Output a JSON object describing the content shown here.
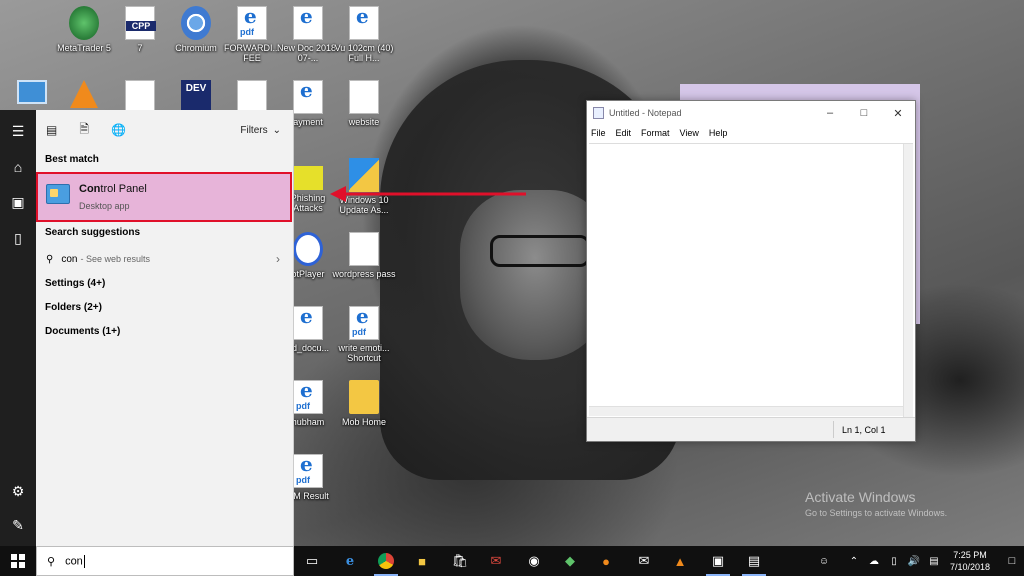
{
  "desktop": {
    "icons": [
      {
        "label": "MetaTrader 5"
      },
      {
        "label": "7"
      },
      {
        "label": "Chromium"
      },
      {
        "label": "FORWARDI... FEE"
      },
      {
        "label": "New Doc 2018-07-..."
      },
      {
        "label": "Vu 102cm (40) Full H..."
      },
      {
        "label": "ayment"
      },
      {
        "label": "website"
      },
      {
        "label": "Phishing Attacks"
      },
      {
        "label": "Windows 10 Update As..."
      },
      {
        "label": "otPlayer"
      },
      {
        "label": "wordpress pass"
      },
      {
        "label": "ed_docu..."
      },
      {
        "label": "write emoti... Shortcut"
      },
      {
        "label": "hubham"
      },
      {
        "label": "Mob Home"
      },
      {
        "label": "EM Result"
      }
    ],
    "cpp_badge": "CPP",
    "dev_badge": "DEV"
  },
  "notepad": {
    "title": "Untitled - Notepad",
    "menu": [
      "File",
      "Edit",
      "Format",
      "View",
      "Help"
    ],
    "status": "Ln 1, Col 1"
  },
  "search_panel": {
    "filters_label": "Filters",
    "best_match_heading": "Best match",
    "best_match": {
      "title_bold": "Con",
      "title_rest": "trol Panel",
      "subtitle": "Desktop app"
    },
    "suggestions_heading": "Search suggestions",
    "suggestion": {
      "query": "con",
      "sub": "- See web results"
    },
    "categories": [
      "Settings (4+)",
      "Folders (2+)",
      "Documents (1+)"
    ],
    "query": "con"
  },
  "watermark": {
    "line1": "Activate Windows",
    "line2": "Go to Settings to activate Windows."
  },
  "taskbar": {
    "time": "7:25 PM",
    "date": "7/10/2018"
  },
  "colors": {
    "highlight": "#e7b4d9",
    "highlight_border": "#e0102a",
    "arrow": "#e0102a"
  }
}
